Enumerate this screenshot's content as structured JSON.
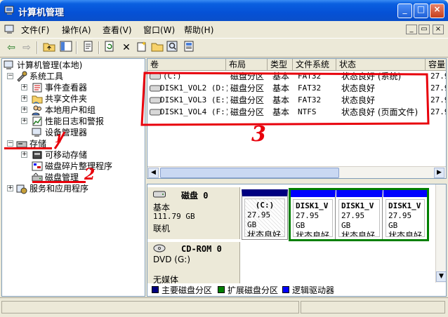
{
  "window": {
    "title": "计算机管理",
    "minimize_glyph": "_",
    "maximize_glyph": "□",
    "close_glyph": "×"
  },
  "menu": {
    "items": [
      "文件(F)",
      "操作(A)",
      "查看(V)",
      "窗口(W)",
      "帮助(H)"
    ],
    "mdi_min": "_",
    "mdi_restore": "▭",
    "mdi_close": "×"
  },
  "toolbar": {
    "icons": [
      "back-arrow-icon",
      "forward-arrow-icon",
      "up-folder-icon",
      "show-hide-tree-icon",
      "properties-icon",
      "refresh-icon",
      "delete-icon",
      "new-icon",
      "open-icon",
      "search-icon",
      "help-icon"
    ]
  },
  "tree": {
    "root": "计算机管理(本地)",
    "system_tools": "系统工具",
    "event_viewer": "事件查看器",
    "shared_folders": "共享文件夹",
    "local_users": "本地用户和组",
    "perf_logs": "性能日志和警报",
    "device_manager": "设备管理器",
    "storage": "存储",
    "removable": "可移动存储",
    "defrag": "磁盘碎片整理程序",
    "disk_mgmt": "磁盘管理",
    "services_apps": "服务和应用程序"
  },
  "volume_list": {
    "headers": [
      "卷",
      "布局",
      "类型",
      "文件系统",
      "状态",
      "容量"
    ],
    "rows": [
      {
        "vol": "(C:)",
        "layout": "磁盘分区",
        "type": "基本",
        "fs": "FAT32",
        "status": "状态良好 (系统)",
        "cap": "27.9"
      },
      {
        "vol": "DISK1_VOL2 (D:)",
        "layout": "磁盘分区",
        "type": "基本",
        "fs": "FAT32",
        "status": "状态良好",
        "cap": "27.9"
      },
      {
        "vol": "DISK1_VOL3 (E:)",
        "layout": "磁盘分区",
        "type": "基本",
        "fs": "FAT32",
        "status": "状态良好",
        "cap": "27.9"
      },
      {
        "vol": "DISK1_VOL4 (F:)",
        "layout": "磁盘分区",
        "type": "基本",
        "fs": "NTFS",
        "status": "状态良好 (页面文件)",
        "cap": "27.9"
      }
    ]
  },
  "disks": {
    "disk0": {
      "name": "磁盘 0",
      "type": "基本",
      "size": "111.79 GB",
      "state": "联机"
    },
    "partitions": [
      {
        "name": "(C:)",
        "size": "27.95 GB",
        "status": "状态良好"
      },
      {
        "name": "DISK1_V",
        "size": "27.95 GB",
        "status": "状态良好"
      },
      {
        "name": "DISK1_V",
        "size": "27.95 GB",
        "status": "状态良好"
      },
      {
        "name": "DISK1_V",
        "size": "27.95 GB",
        "status": "状态良好"
      }
    ],
    "cdrom": {
      "name": "CD-ROM 0",
      "type": "DVD (G:)",
      "state": "无媒体"
    }
  },
  "legend": [
    {
      "label": "主要磁盘分区",
      "color": "#000080"
    },
    {
      "label": "扩展磁盘分区",
      "color": "#008000"
    },
    {
      "label": "逻辑驱动器",
      "color": "#0000ff"
    }
  ],
  "annotations": [
    "1",
    "2",
    "3"
  ],
  "colors": {
    "accent": "#0a5fe0",
    "annotation": "#e8000b"
  }
}
